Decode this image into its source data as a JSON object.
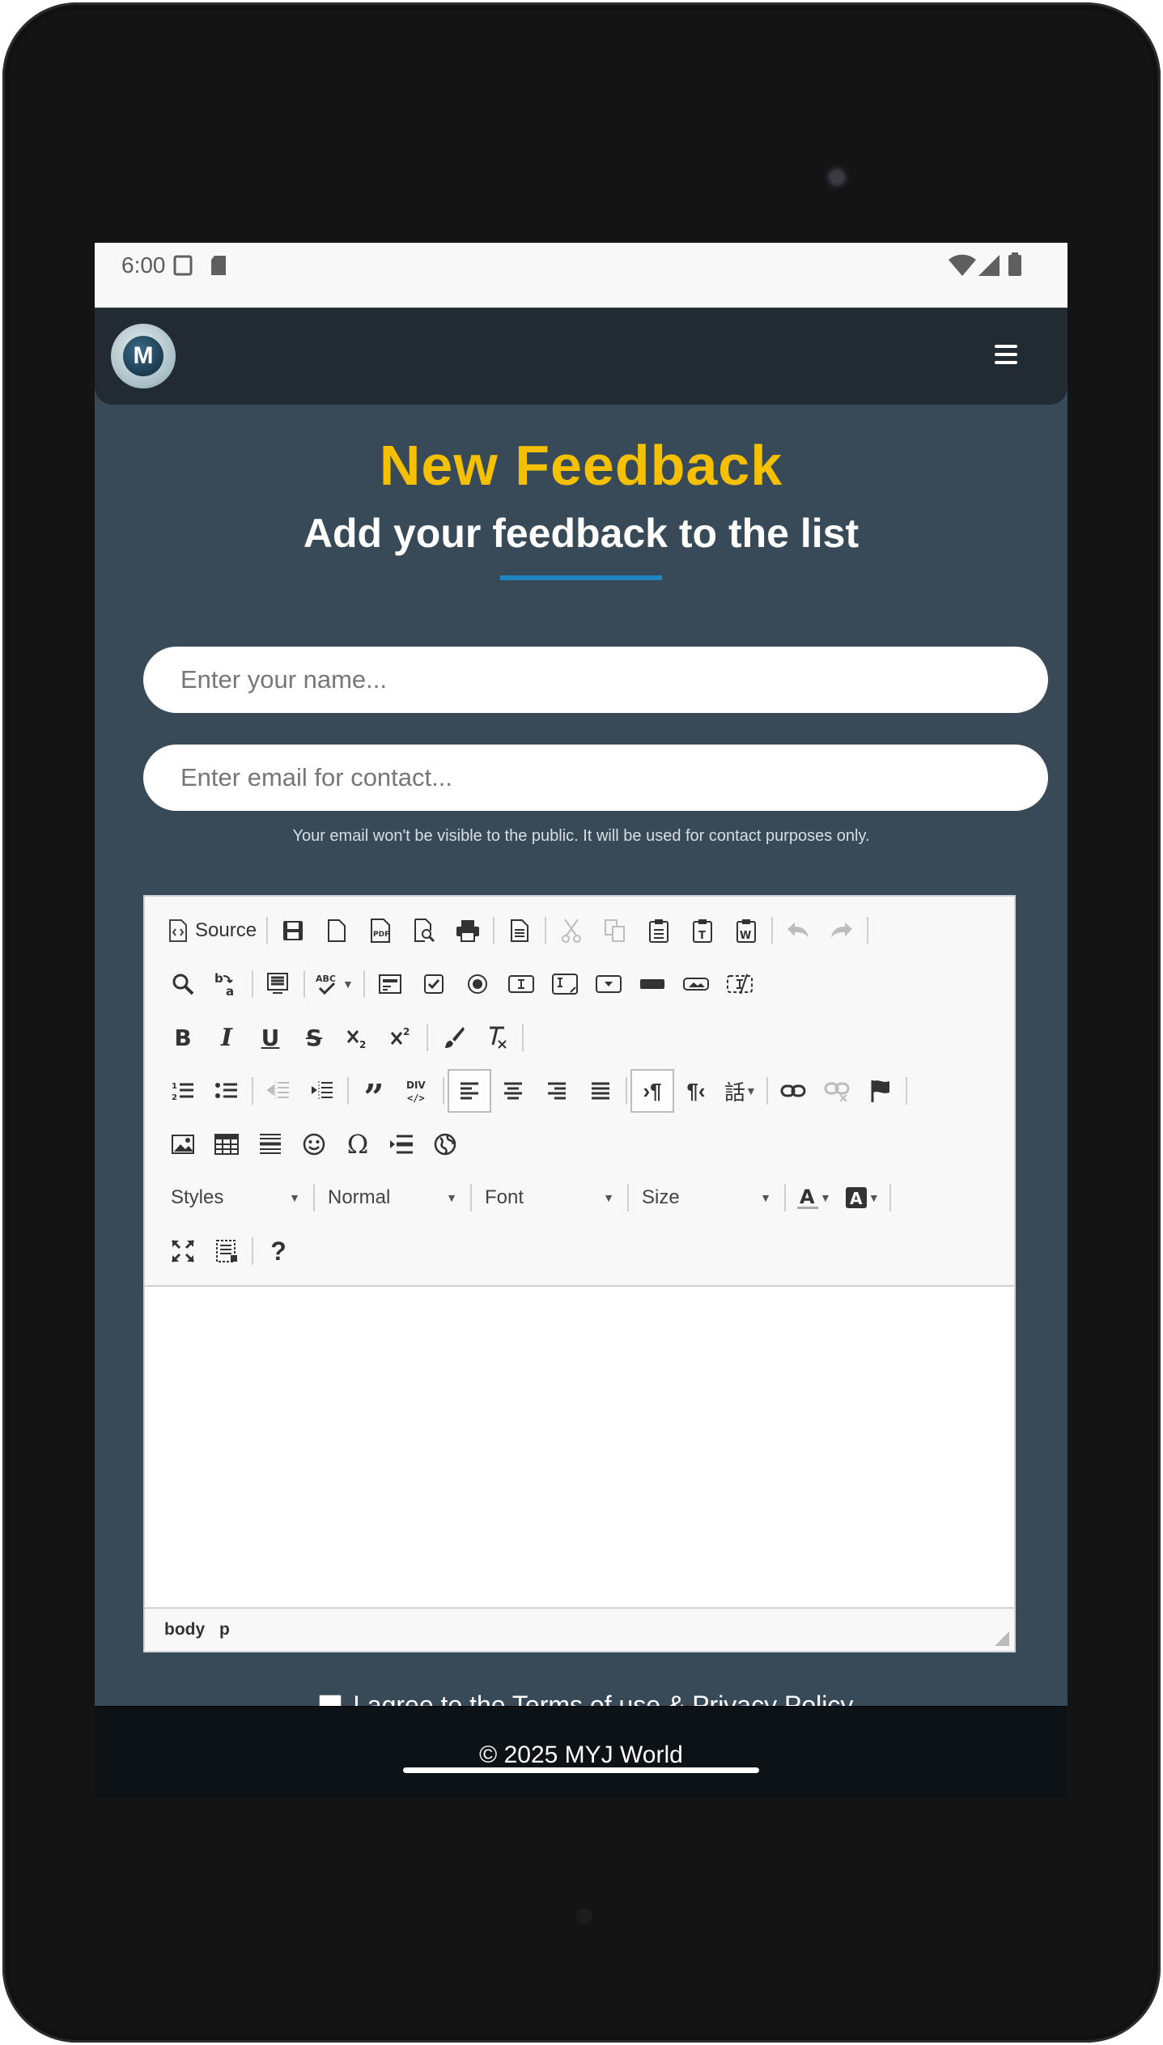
{
  "status_bar": {
    "time": "6:00"
  },
  "header": {
    "logo_letter": "M"
  },
  "page": {
    "title": "New Feedback",
    "subtitle": "Add your feedback to the list"
  },
  "form": {
    "name_placeholder": "Enter your name...",
    "email_placeholder": "Enter email for contact...",
    "email_note": "Your email won't be visible to the public. It will be used for contact purposes only.",
    "terms_label": "I agree to the Terms of use & Privacy Policy"
  },
  "editor": {
    "source_label": "Source",
    "styles_label": "Styles",
    "format_label": "Normal",
    "font_label": "Font",
    "size_label": "Size",
    "path": [
      "body",
      "p"
    ]
  },
  "footer": {
    "copyright": "© 2025 MYJ World"
  }
}
